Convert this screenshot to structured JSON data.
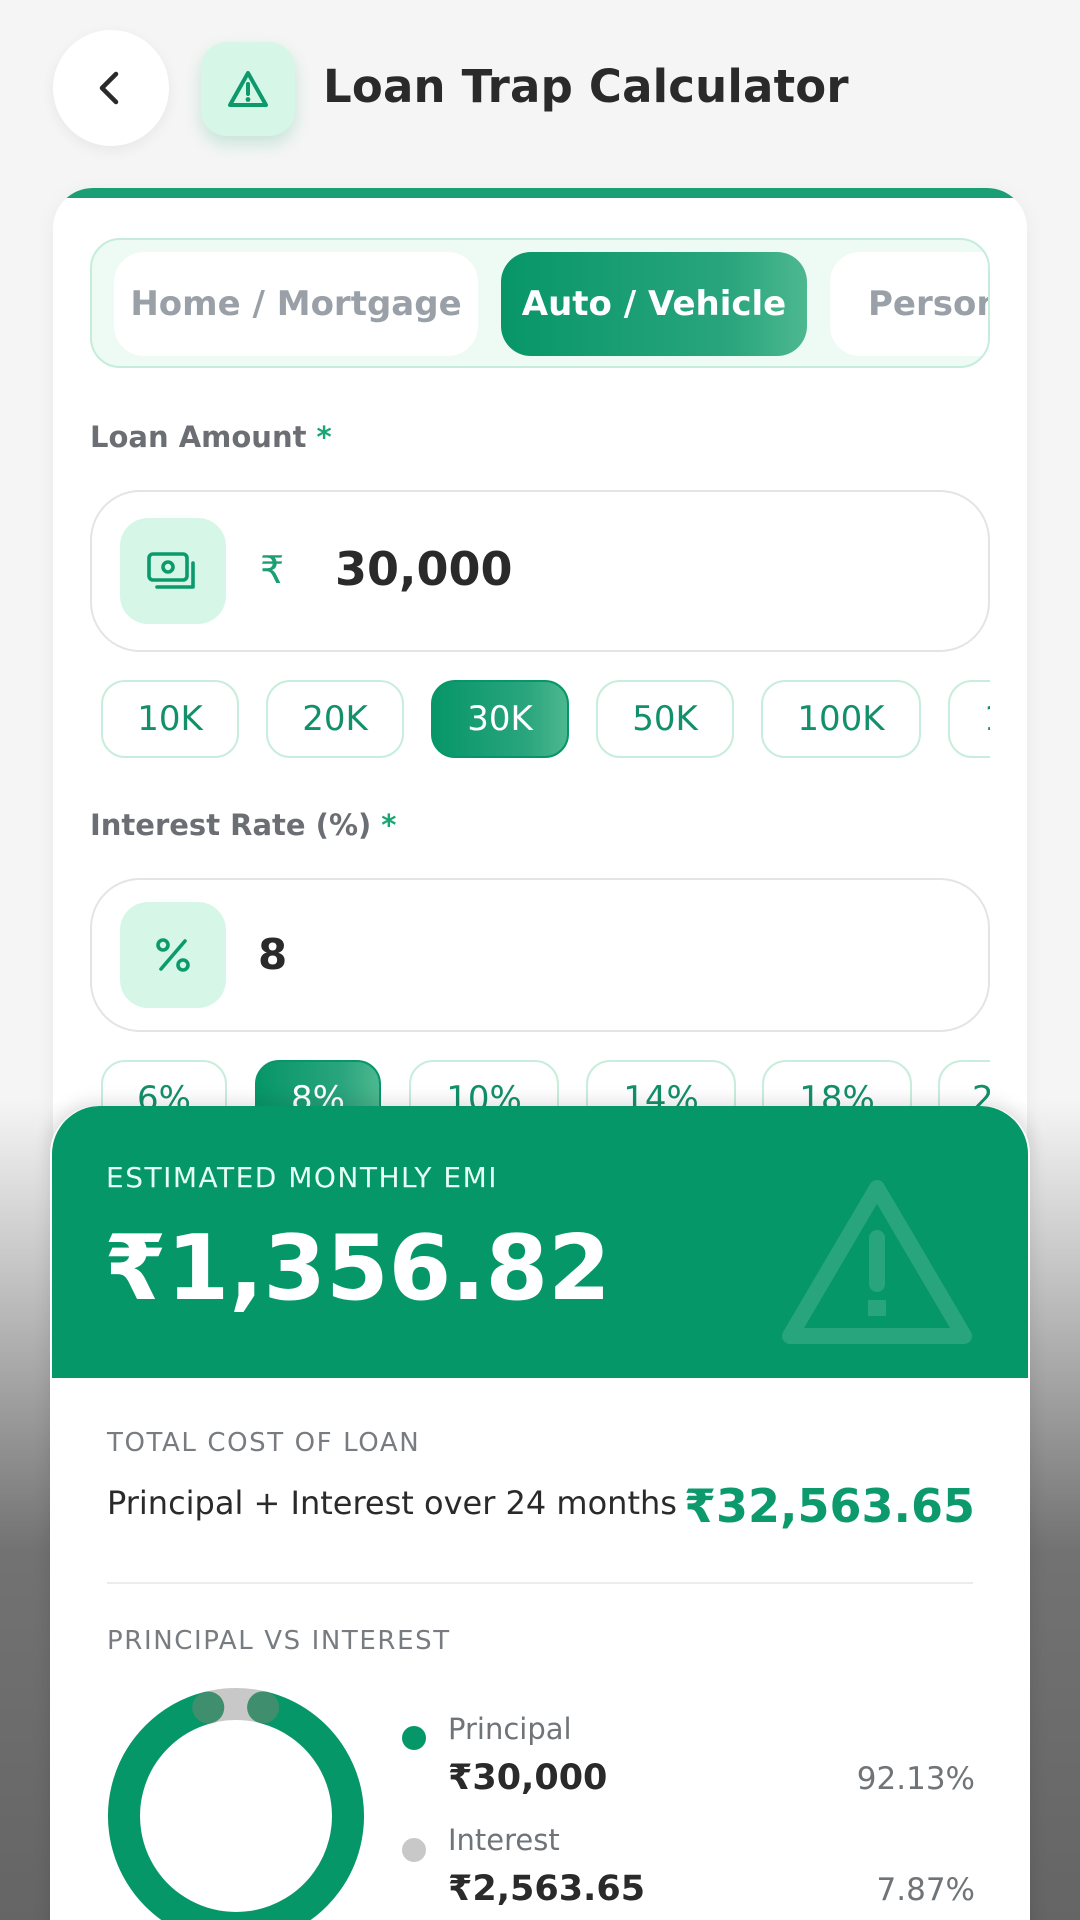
{
  "header": {
    "title": "Loan Trap Calculator",
    "back_icon": "chevron-left-icon",
    "badge_icon": "warning-triangle-icon"
  },
  "tabs": [
    {
      "label": "Home / Mortgage",
      "active": false
    },
    {
      "label": "Auto / Vehicle",
      "active": true
    },
    {
      "label": "Person",
      "active": false
    }
  ],
  "loan_amount": {
    "label": "Loan Amount",
    "required_mark": "*",
    "icon": "cash-icon",
    "currency": "₹",
    "value": "30,000",
    "chips": [
      {
        "label": "10K",
        "active": false
      },
      {
        "label": "20K",
        "active": false
      },
      {
        "label": "30K",
        "active": true
      },
      {
        "label": "50K",
        "active": false
      },
      {
        "label": "100K",
        "active": false
      },
      {
        "label": "1",
        "active": false
      }
    ]
  },
  "interest_rate": {
    "label": "Interest Rate (%)",
    "required_mark": "*",
    "icon": "percent-icon",
    "value": "8",
    "chips": [
      {
        "label": "6%",
        "active": false
      },
      {
        "label": "8%",
        "active": true
      },
      {
        "label": "10%",
        "active": false
      },
      {
        "label": "14%",
        "active": false
      },
      {
        "label": "18%",
        "active": false
      },
      {
        "label": "2",
        "active": false
      }
    ]
  },
  "result": {
    "emi_label": "ESTIMATED MONTHLY EMI",
    "emi_value": "₹1,356.82",
    "total_label": "TOTAL COST OF LOAN",
    "total_desc": "Principal + Interest over 24 months",
    "total_value": "₹32,563.65",
    "breakdown_label": "PRINCIPAL VS INTEREST",
    "principal": {
      "name": "Principal",
      "amount": "₹30,000",
      "percent": "92.13%",
      "fraction": 0.9213
    },
    "interest": {
      "name": "Interest",
      "amount": "₹2,563.65",
      "percent": "7.87%",
      "fraction": 0.0787
    }
  },
  "colors": {
    "accent": "#069769",
    "accent_light": "#d6f7e7",
    "interest_grey": "#c8c8c8"
  }
}
